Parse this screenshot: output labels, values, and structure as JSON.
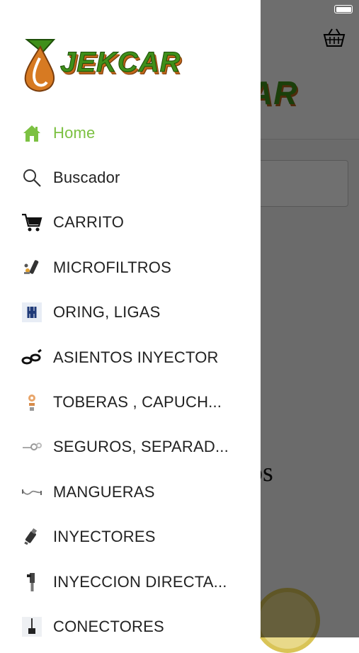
{
  "status_bar": {
    "battery_level": 1.0
  },
  "background": {
    "logo_fragment": "AR",
    "text_fragment": "os"
  },
  "drawer": {
    "logo_text": "JEKCAR",
    "menu": [
      {
        "label": "Home",
        "icon": "home-icon",
        "active": true,
        "color": "#7cc142"
      },
      {
        "label": "Buscador",
        "icon": "search-icon"
      },
      {
        "label": "CARRITO",
        "icon": "cart-icon"
      },
      {
        "label": "MICROFILTROS",
        "icon": "microfilter-icon"
      },
      {
        "label": "ORING, LIGAS",
        "icon": "oring-icon"
      },
      {
        "label": "ASIENTOS INYECTOR",
        "icon": "injector-seat-icon"
      },
      {
        "label": "TOBERAS , CAPUCH...",
        "icon": "nozzle-icon"
      },
      {
        "label": "SEGUROS, SEPARAD...",
        "icon": "clip-icon"
      },
      {
        "label": "MANGUERAS",
        "icon": "hose-icon"
      },
      {
        "label": "INYECTORES",
        "icon": "injector-icon"
      },
      {
        "label": "INYECCION DIRECTA...",
        "icon": "direct-injection-icon"
      },
      {
        "label": "CONECTORES",
        "icon": "connector-icon"
      }
    ]
  }
}
